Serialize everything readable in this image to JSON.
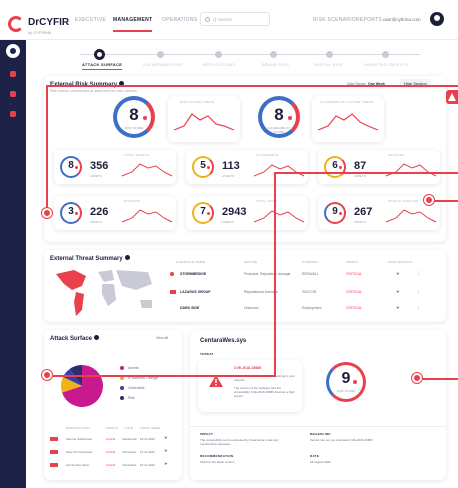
{
  "header": {
    "brand": "DrCYFIR",
    "brand_sub": "by CYFIRMA",
    "nav": [
      "EXECUTIVE",
      "MANAGEMENT",
      "OPERATIONS"
    ],
    "search_placeholder": "Q  Search",
    "right_nav": [
      "RISK SCENARIO",
      "REPORTS"
    ],
    "user_email": "user@cyfirma.com"
  },
  "stepper": {
    "steps": [
      "ATTACK SURFACE",
      "VULNERABILITIES",
      "APPLICATIONS",
      "BRAND RISK",
      "DIGITAL RISK",
      "IMPACTED IDENTITY"
    ]
  },
  "risk_summary": {
    "title": "External Risk Summary",
    "subtitle": "Risk metrics summarized at asset level for each domain",
    "date_range_label": "Date Range",
    "date_range_value": "One Week",
    "hide_section": "Hide Section",
    "gauges": [
      {
        "value": "8",
        "label": "RISK SCORE"
      },
      {
        "value": "8",
        "label": "VULNERABILITY SCORE"
      }
    ],
    "spark_captions": [
      "RISK SCORE TREND",
      "VULNERABILITY SCORE TREND"
    ],
    "tiles": [
      {
        "score": "8",
        "count": "356",
        "count_label": "ASSETS",
        "caption": "TOTAL ASSETS"
      },
      {
        "score": "5",
        "count": "113",
        "count_label": "ASSETS",
        "caption": "VULNERABLE"
      },
      {
        "score": "6",
        "count": "87",
        "count_label": "ASSETS",
        "caption": "EXPOSED"
      },
      {
        "score": "3",
        "count": "226",
        "count_label": "ASSETS",
        "caption": "DOMAINS"
      },
      {
        "score": "7",
        "count": "2943",
        "count_label": "ASSETS",
        "caption": "TOTAL OPEN"
      },
      {
        "score": "9",
        "count": "267",
        "count_label": "ASSETS",
        "caption": "ATTACK SURFACE"
      }
    ]
  },
  "threat_summary": {
    "title": "External Threat Summary",
    "columns": [
      "CAMPAIGN NAME",
      "MOTIVE",
      "COMPANY",
      "IMPACT",
      "VIEW DETAILS"
    ],
    "rows": [
      {
        "name": "STORMBRIDGE",
        "motive": "Financial, Reputation damage",
        "company": "REDWALL",
        "impact": "CRITICAL"
      },
      {
        "name": "LAZARUS GROUP",
        "motive": "Reputational Damage",
        "company": "ZAYCOR",
        "impact": "CRITICAL"
      },
      {
        "name": "DARK SIDE",
        "motive": "Unknown",
        "company": "Employment",
        "impact": "CRITICAL"
      }
    ]
  },
  "attack_surface": {
    "title": "Attack Surface",
    "view_all": "View all",
    "legend": [
      "Assets",
      "IP Address / Range",
      "Vulnerable",
      "Risk"
    ],
    "columns": [
      "DESCRIPTION",
      "IMPACT",
      "TYPE",
      "FIRST SEEN"
    ],
    "rows": [
      {
        "desc": "Sample Subdomain",
        "impact": "Critical",
        "type": "Subdomain",
        "date": "18.11.2022"
      },
      {
        "desc": "Open Port Exposed",
        "impact": "Critical",
        "type": "Vulnerable",
        "date": "16.11.2022"
      },
      {
        "desc": "Api Service Open",
        "impact": "Critical",
        "type": "Vulnerable",
        "date": "16.11.2022"
      }
    ]
  },
  "detail": {
    "title": "CentaraWes.sys",
    "threat_label": "THREAT",
    "cve": "CVE-2018-15686",
    "cve_text": "Vulnerable version of software running in your network",
    "cve_text2": "The version of the software has the vulnerability CVE-2018-15686 that has a high impact",
    "score": "9",
    "score_label": "RISK SCORE",
    "impact_label": "IMPACT",
    "impact_text": "The vulnerability can be exploited by threat actor under any membership campaign",
    "mitigation_label": "MAGEDLINK",
    "mitigation_text": "Vendor site not yet estimated CVE-2018-15686",
    "rec_label": "RECOMMENDATION",
    "rec_text": "Patch to the latest version",
    "date_label": "DATE",
    "date_text": "18 August 2022"
  },
  "chart_data": {
    "type": "pie",
    "categories": [
      "Assets",
      "IP Address / Range",
      "Vulnerable",
      "Risk"
    ],
    "values": [
      70,
      12,
      8,
      10
    ],
    "colors": [
      "#c8198f",
      "#f0b21a",
      "#3b3fa8",
      "#2b2e6b"
    ]
  }
}
